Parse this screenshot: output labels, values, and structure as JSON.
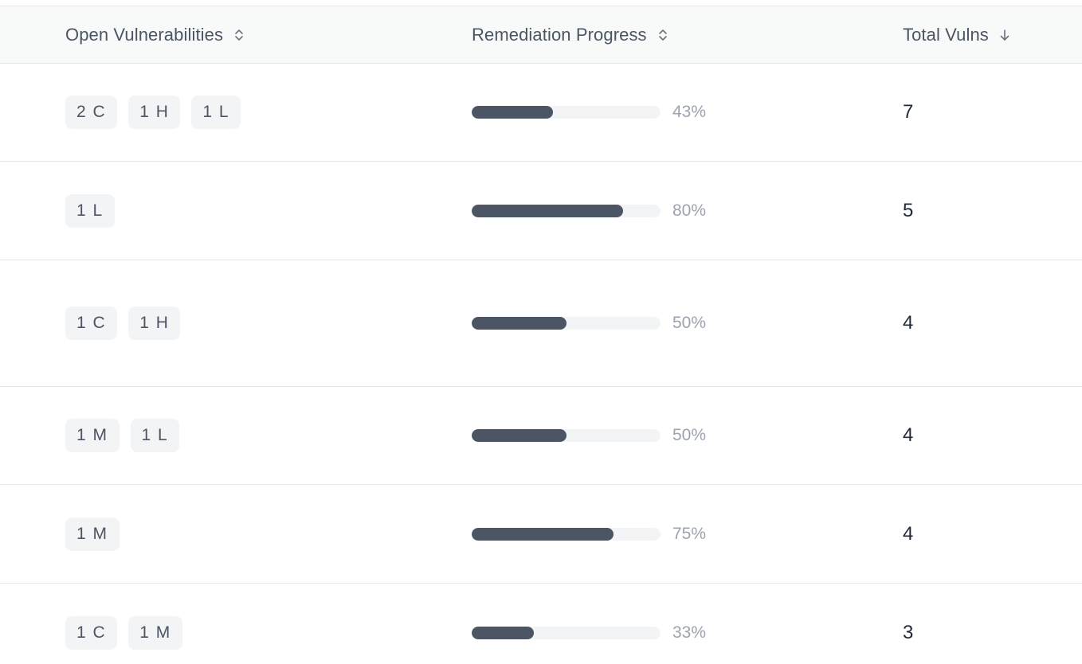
{
  "columns": {
    "open": "Open Vulnerabilities",
    "progress": "Remediation Progress",
    "total": "Total Vulns"
  },
  "icons": {
    "open_sort": "sort-updown-icon",
    "progress_sort": "sort-updown-icon",
    "total_sort": "arrow-down-icon"
  },
  "colors": {
    "bar_fill": "#4b5563",
    "bar_track": "#f3f4f6",
    "badge_bg": "#f3f4f6",
    "header_bg": "#f8faf9"
  },
  "rows": [
    {
      "badges": [
        "2 C",
        "1 H",
        "1 L"
      ],
      "progress": 43,
      "progress_label": "43%",
      "total": "7"
    },
    {
      "badges": [
        "1 L"
      ],
      "progress": 80,
      "progress_label": "80%",
      "total": "5"
    },
    {
      "badges": [
        "1 C",
        "1 H"
      ],
      "progress": 50,
      "progress_label": "50%",
      "total": "4"
    },
    {
      "badges": [
        "1 M",
        "1 L"
      ],
      "progress": 50,
      "progress_label": "50%",
      "total": "4"
    },
    {
      "badges": [
        "1 M"
      ],
      "progress": 75,
      "progress_label": "75%",
      "total": "4"
    },
    {
      "badges": [
        "1 C",
        "1 M"
      ],
      "progress": 33,
      "progress_label": "33%",
      "total": "3"
    }
  ]
}
